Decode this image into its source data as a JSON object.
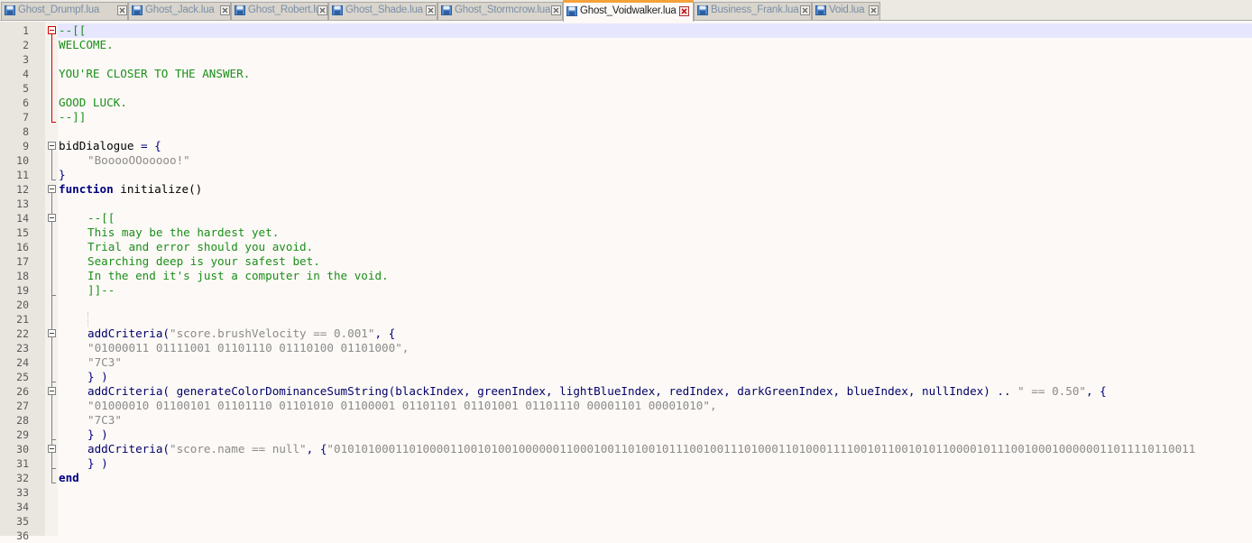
{
  "tabs": [
    {
      "label": "Ghost_Drumpf.lua",
      "active": false
    },
    {
      "label": "Ghost_Jack.lua",
      "active": false
    },
    {
      "label": "Ghost_Robert.lua",
      "active": false
    },
    {
      "label": "Ghost_Shade.lua",
      "active": false
    },
    {
      "label": "Ghost_Stormcrow.lua",
      "active": false
    },
    {
      "label": "Ghost_Voidwalker.lua",
      "active": true
    },
    {
      "label": "Business_Frank.lua",
      "active": false
    },
    {
      "label": "Void.lua",
      "active": false
    }
  ],
  "icons": {
    "file": "floppy-file-icon",
    "close": "close-tab-icon",
    "fold": "fold-minus-icon"
  },
  "colors": {
    "comment": "#1b8f1b",
    "keyword": "#00007f",
    "string": "#8b8b8b",
    "current_line": "#e6e6ff",
    "active_tab_accent": "#f6a13a"
  },
  "line_numbers": [
    "1",
    "2",
    "3",
    "4",
    "5",
    "6",
    "7",
    "8",
    "9",
    "10",
    "11",
    "12",
    "13",
    "14",
    "15",
    "16",
    "17",
    "18",
    "19",
    "20",
    "21",
    "22",
    "23",
    "24",
    "25",
    "26",
    "27",
    "28",
    "29",
    "30",
    "31",
    "32",
    "33",
    "34",
    "35",
    "36"
  ],
  "code": {
    "l1": "--[[",
    "l2": "WELCOME.",
    "l4": "YOU'RE CLOSER TO THE ANSWER.",
    "l6": "GOOD LUCK.",
    "l7": "--]]",
    "l9_id": "bidDialogue",
    "l9_op": " = {",
    "l10": "\"BooooOOooooo!\"",
    "l11": "}",
    "l12_kw": "function",
    "l12_rest": " initialize()",
    "l14": "--[[",
    "l15": "This may be the hardest yet.",
    "l16": "Trial and error should you avoid.",
    "l17": "Searching deep is your safest bet.",
    "l18": "In the end it's just a computer in the void.",
    "l19": "]]--",
    "l22_fn": "addCriteria(",
    "l22_str": "\"score.brushVelocity == 0.001\"",
    "l22_rest": ", {",
    "l23": "\"01000011 01111001 01101110 01110100 01101000\",",
    "l24": "\"7C3\"",
    "l25": "} )",
    "l26_fn": "addCriteria( generateColorDominanceSumString(blackIndex, greenIndex, lightBlueIndex, redIndex, darkGreenIndex, blueIndex, nullIndex) .. ",
    "l26_str": "\" == 0.50\"",
    "l26_rest": ", {",
    "l27": "\"01000010 01100101 01101110 01101010 01100001 01101101 01101001 01101110 00001101 00001010\",",
    "l28": "\"7C3\"",
    "l29": "} )",
    "l30_fn": "addCriteria(",
    "l30_str": "\"score.name == null\"",
    "l30_mid": ", {",
    "l30_str2": "\"010101000110100001100101001000000110001001101001011100100111010001101000111100101100101011000010111001000100000011011110110011",
    "l31": "} )",
    "l32_kw": "end"
  }
}
